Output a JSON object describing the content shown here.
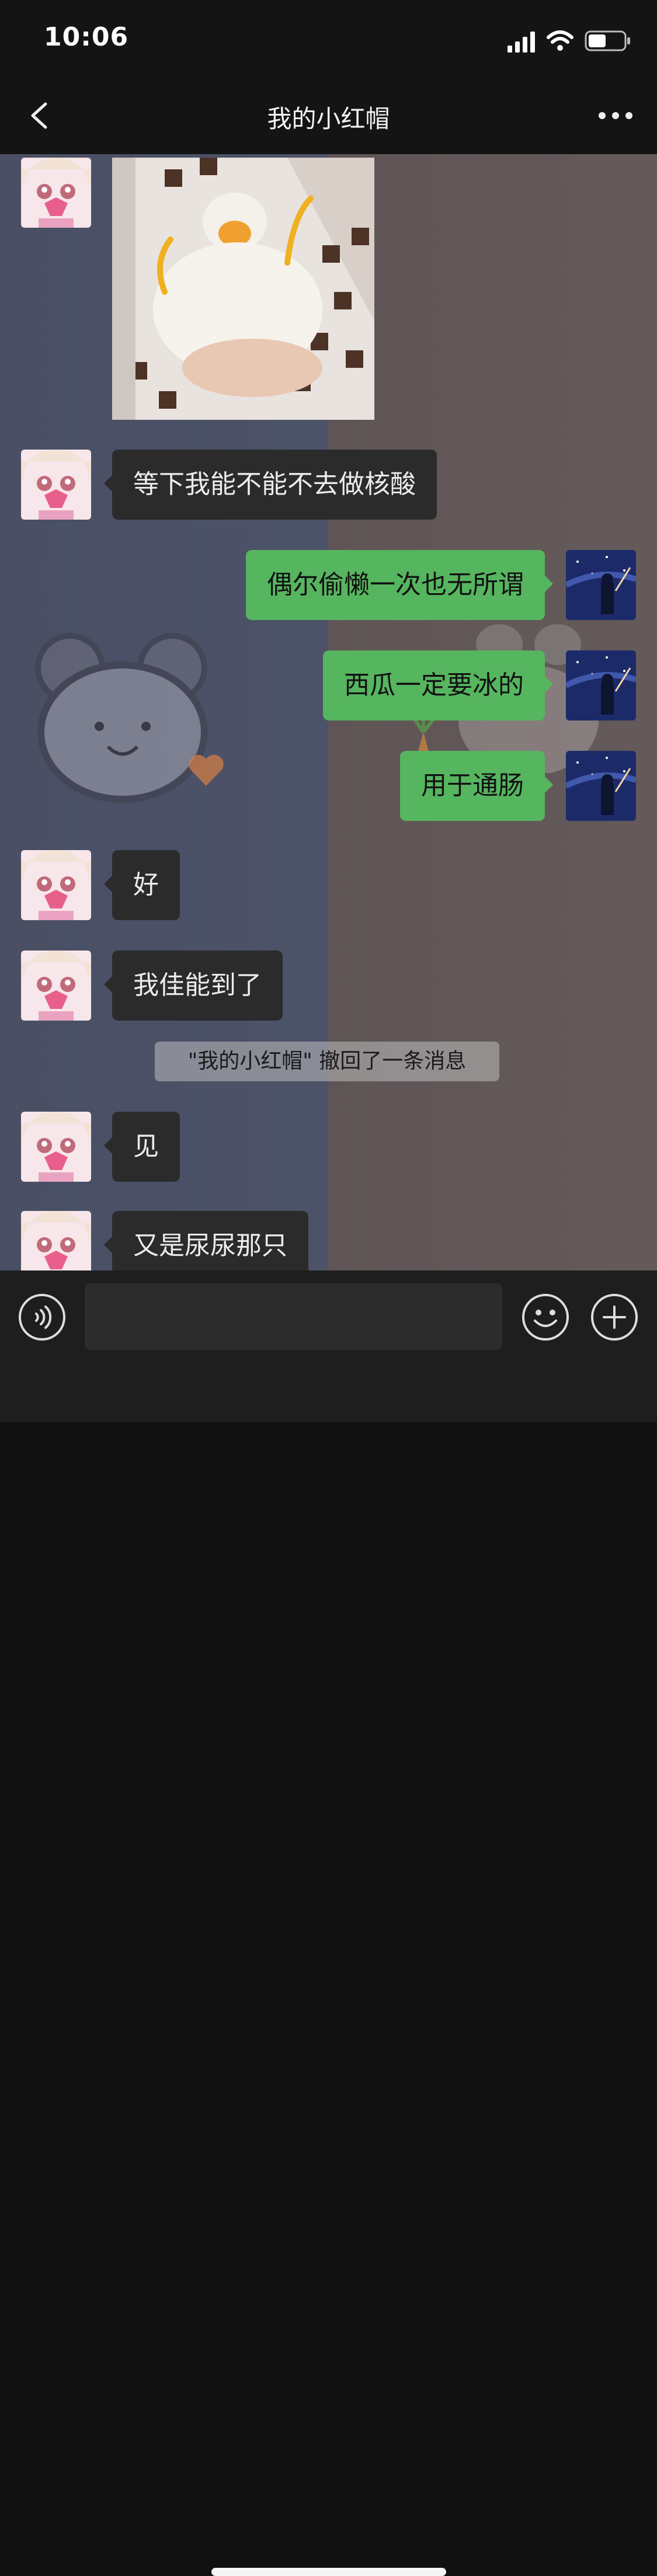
{
  "status_bar": {
    "time": "10:06",
    "battery_level": 0.5
  },
  "header": {
    "title": "我的小红帽",
    "back_icon": "chevron-left-icon",
    "more_icon": "more-dots-icon"
  },
  "messages": [
    {
      "type": "image",
      "side": "left",
      "image": "white duck with orange headphones held in hand"
    },
    {
      "type": "text",
      "side": "left",
      "text": "等下我能不能不去做核酸"
    },
    {
      "type": "text",
      "side": "right",
      "text": "偶尔偷懒一次也无所谓"
    },
    {
      "type": "text",
      "side": "right",
      "text": "西瓜一定要冰的"
    },
    {
      "type": "text",
      "side": "right",
      "text": "用于通肠"
    },
    {
      "type": "text",
      "side": "left",
      "text": "好"
    },
    {
      "type": "text",
      "side": "left",
      "text": "我佳能到了"
    },
    {
      "type": "system",
      "text": "\"我的小红帽\" 撤回了一条消息"
    },
    {
      "type": "text",
      "side": "left",
      "text": "见"
    },
    {
      "type": "text",
      "side": "left",
      "text": "又是尿尿那只"
    }
  ],
  "input_bar": {
    "placeholder": "",
    "voice_icon": "voice-icon",
    "emoji_icon": "emoji-icon",
    "plus_icon": "plus-icon"
  },
  "colors": {
    "incoming_bubble": "#2b2b2b",
    "outgoing_bubble": "#56b55f",
    "bar": "#141414"
  }
}
